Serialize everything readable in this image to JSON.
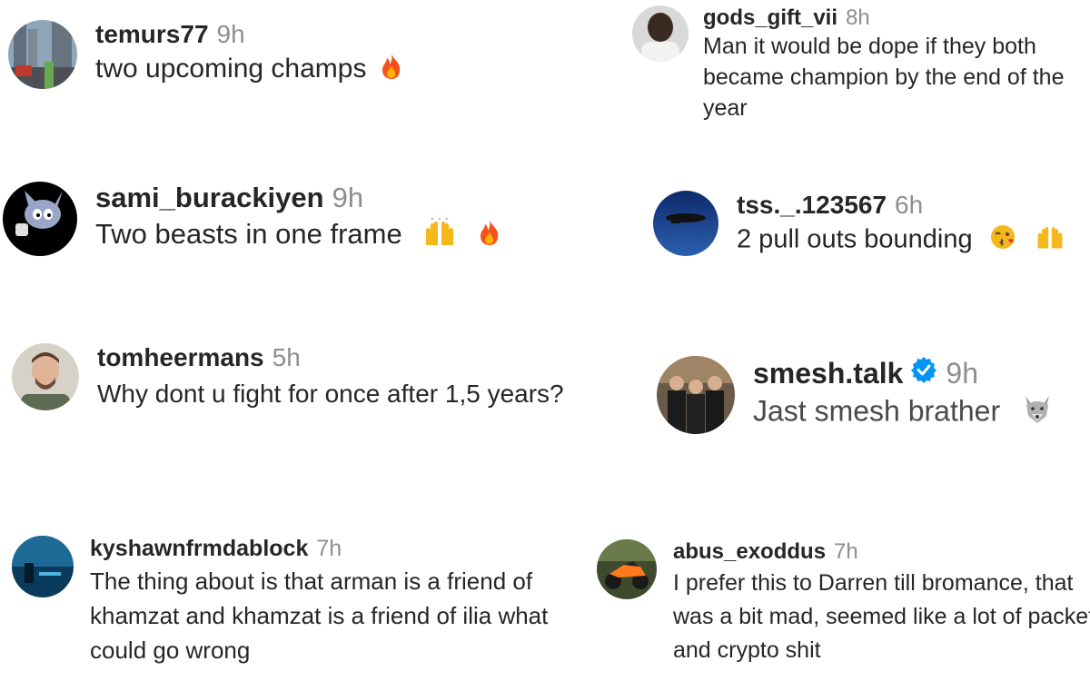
{
  "comments": [
    {
      "username": "temurs77",
      "time": "9h",
      "text": "two upcoming champs",
      "emojis": [
        "fire-emoji"
      ]
    },
    {
      "username": "gods_gift_vii",
      "time": "8h",
      "text": "Man it would be dope if they both became champion by the end of the year",
      "emojis": []
    },
    {
      "username": "sami_burackiyen",
      "time": "9h",
      "text": "Two beasts in one frame",
      "emojis": [
        "raising-hands-emoji",
        "fire-emoji"
      ]
    },
    {
      "username": "tss._.123567",
      "time": "6h",
      "text": "2 pull outs bounding",
      "emojis": [
        "kissing-face-emoji",
        "raising-hands-emoji"
      ]
    },
    {
      "username": "tomheermans",
      "time": "5h",
      "text": "Why dont u fight for once after 1,5 years?",
      "emojis": []
    },
    {
      "username": "smesh.talk",
      "time": "9h",
      "text": "Jast smesh brather",
      "verified": true,
      "emojis": [
        "wolf-emoji"
      ]
    },
    {
      "username": "kyshawnfrmdablock",
      "time": "7h",
      "text": "The thing about is that arman is a friend of khamzat and khamzat is a friend of ilia what could go wrong",
      "emojis": []
    },
    {
      "username": "abus_exoddus",
      "time": "7h",
      "text": "I prefer this to Darren till bromance, that was a bit mad, seemed like a lot of packet and crypto shit",
      "emojis": []
    }
  ],
  "colors": {
    "username": "#262626",
    "time": "#8e8e8e",
    "text": "#262626",
    "verified_badge": "#0095f6",
    "fire": "#f4511e",
    "raising_hands": "#f5b81c"
  }
}
